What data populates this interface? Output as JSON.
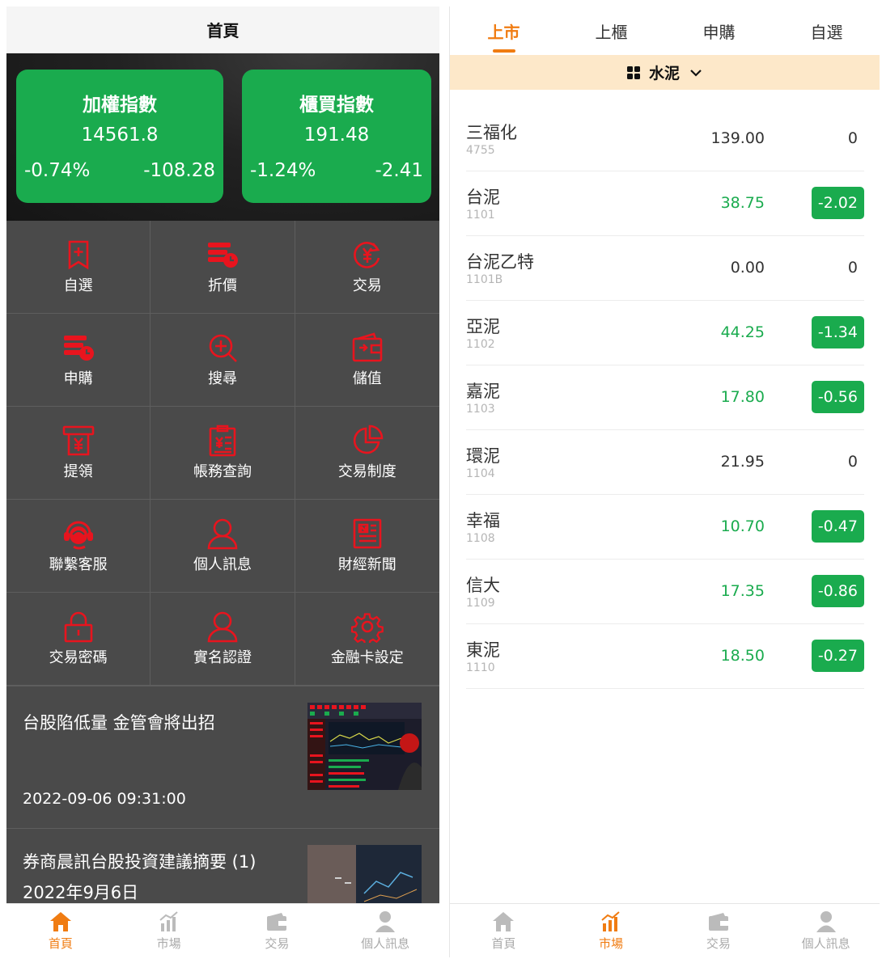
{
  "home": {
    "title": "首頁",
    "indices": [
      {
        "name": "加權指數",
        "value": "14561.8",
        "pct": "-0.74%",
        "change": "-108.28"
      },
      {
        "name": "櫃買指數",
        "value": "191.48",
        "pct": "-1.24%",
        "change": "-2.41"
      }
    ],
    "menu": [
      {
        "label": "自選",
        "icon": "bookmark-plus-icon"
      },
      {
        "label": "折價",
        "icon": "discount-stack-icon"
      },
      {
        "label": "交易",
        "icon": "yen-refresh-icon"
      },
      {
        "label": "申購",
        "icon": "subscribe-stack-icon"
      },
      {
        "label": "搜尋",
        "icon": "search-plus-icon"
      },
      {
        "label": "儲值",
        "icon": "wallet-icon"
      },
      {
        "label": "提領",
        "icon": "withdraw-atm-icon"
      },
      {
        "label": "帳務查詢",
        "icon": "statement-icon"
      },
      {
        "label": "交易制度",
        "icon": "pie-chart-icon"
      },
      {
        "label": "聯繫客服",
        "icon": "customer-service-icon"
      },
      {
        "label": "個人訊息",
        "icon": "user-icon"
      },
      {
        "label": "財經新聞",
        "icon": "newspaper-icon"
      },
      {
        "label": "交易密碼",
        "icon": "lock-icon"
      },
      {
        "label": "實名認證",
        "icon": "user-verify-icon"
      },
      {
        "label": "金融卡設定",
        "icon": "gear-icon"
      }
    ],
    "news": [
      {
        "headline": "台股陷低量 金管會將出招",
        "date": "2022-09-06 09:31:00"
      },
      {
        "headline": "券商晨訊台股投資建議摘要 (1) 2022年9月6日",
        "date": ""
      }
    ],
    "tabbar": [
      {
        "label": "首頁",
        "icon": "home-icon"
      },
      {
        "label": "市場",
        "icon": "market-chart-icon"
      },
      {
        "label": "交易",
        "icon": "wallet-icon"
      },
      {
        "label": "個人訊息",
        "icon": "user-icon"
      }
    ],
    "active_tab": 0
  },
  "market": {
    "tabs": [
      "上市",
      "上櫃",
      "申購",
      "自選"
    ],
    "active_tab": 0,
    "category": {
      "label": "水泥",
      "icon": "grid-icon",
      "dropdown_icon": "chevron-down-icon"
    },
    "stocks": [
      {
        "name": "三福化",
        "code": "4755",
        "price": "139.00",
        "change": "0",
        "trend": "flat"
      },
      {
        "name": "台泥",
        "code": "1101",
        "price": "38.75",
        "change": "-2.02",
        "trend": "down"
      },
      {
        "name": "台泥乙特",
        "code": "1101B",
        "price": "0.00",
        "change": "0",
        "trend": "flat"
      },
      {
        "name": "亞泥",
        "code": "1102",
        "price": "44.25",
        "change": "-1.34",
        "trend": "down"
      },
      {
        "name": "嘉泥",
        "code": "1103",
        "price": "17.80",
        "change": "-0.56",
        "trend": "down"
      },
      {
        "name": "環泥",
        "code": "1104",
        "price": "21.95",
        "change": "0",
        "trend": "flat"
      },
      {
        "name": "幸福",
        "code": "1108",
        "price": "10.70",
        "change": "-0.47",
        "trend": "down"
      },
      {
        "name": "信大",
        "code": "1109",
        "price": "17.35",
        "change": "-0.86",
        "trend": "down"
      },
      {
        "name": "東泥",
        "code": "1110",
        "price": "18.50",
        "change": "-0.27",
        "trend": "down"
      }
    ],
    "tabbar": [
      {
        "label": "首頁",
        "icon": "home-icon"
      },
      {
        "label": "市場",
        "icon": "market-chart-icon"
      },
      {
        "label": "交易",
        "icon": "wallet-icon"
      },
      {
        "label": "個人訊息",
        "icon": "user-icon"
      }
    ],
    "active_tab_bottom": 1
  },
  "colors": {
    "accent": "#f07c12",
    "down": "#1aab4e",
    "icon_red": "#e8141e",
    "category_bg": "#fde8c9"
  }
}
